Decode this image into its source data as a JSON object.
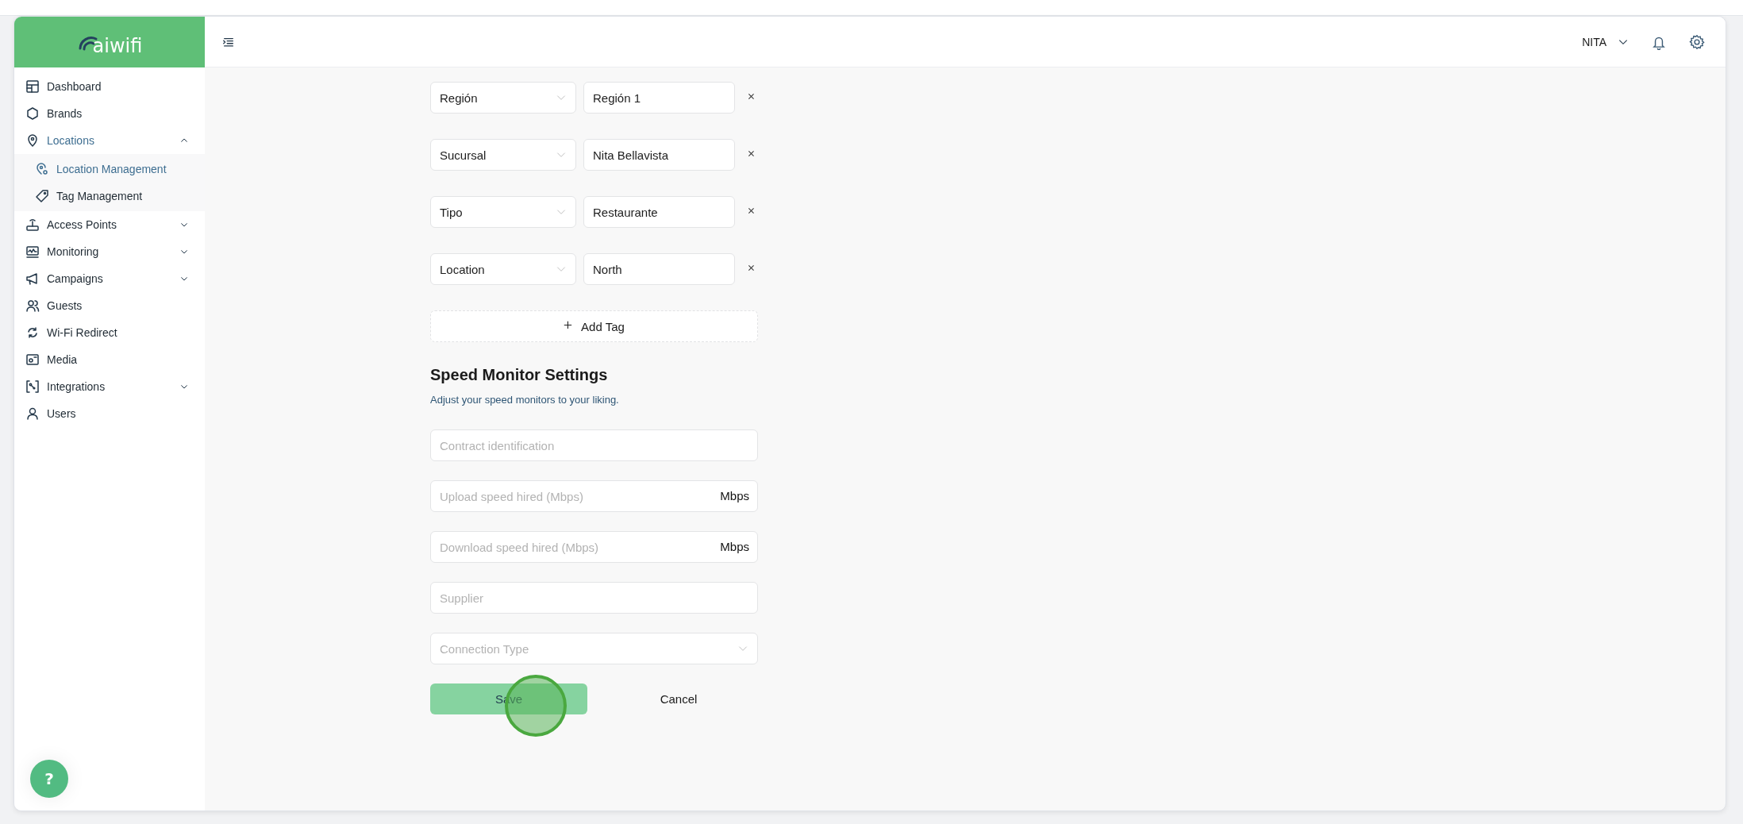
{
  "logo": {
    "text": "aiwifi"
  },
  "sidebar": {
    "items": [
      {
        "label": "Dashboard",
        "selected": false
      },
      {
        "label": "Brands",
        "selected": false
      },
      {
        "label": "Locations",
        "selected": true,
        "expanded": true,
        "children": [
          {
            "label": "Location Management",
            "selected": true
          },
          {
            "label": "Tag Management",
            "selected": false
          }
        ]
      },
      {
        "label": "Access Points",
        "selected": false,
        "expanded": false
      },
      {
        "label": "Monitoring",
        "selected": false,
        "expanded": false
      },
      {
        "label": "Campaigns",
        "selected": false,
        "expanded": false
      },
      {
        "label": "Guests",
        "selected": false
      },
      {
        "label": "Wi-Fi Redirect",
        "selected": false
      },
      {
        "label": "Media",
        "selected": false
      },
      {
        "label": "Integrations",
        "selected": false,
        "expanded": false
      },
      {
        "label": "Users",
        "selected": false
      }
    ]
  },
  "header": {
    "user": "NITA"
  },
  "location_tags": {
    "tags": [
      {
        "key": "Región",
        "value": "Región 1"
      },
      {
        "key": "Sucursal",
        "value": "Nita Bellavista"
      },
      {
        "key": "Tipo",
        "value": "Restaurante"
      },
      {
        "key": "Location",
        "value": "North"
      }
    ],
    "add_button": "Add Tag"
  },
  "speed_monitor": {
    "title": "Speed Monitor Settings",
    "description": "Adjust your speed monitors to your liking.",
    "fields": [
      {
        "kind": "text",
        "placeholder": "Contract identification"
      },
      {
        "kind": "unit",
        "placeholder": "Upload speed hired (Mbps)",
        "unit": "Mbps"
      },
      {
        "kind": "unit",
        "placeholder": "Download speed hired (Mbps)",
        "unit": "Mbps"
      },
      {
        "kind": "text",
        "placeholder": "Supplier"
      },
      {
        "kind": "select",
        "placeholder": "Connection Type"
      }
    ]
  },
  "buttons": {
    "save": "Save",
    "cancel": "Cancel"
  },
  "help_button": "?"
}
